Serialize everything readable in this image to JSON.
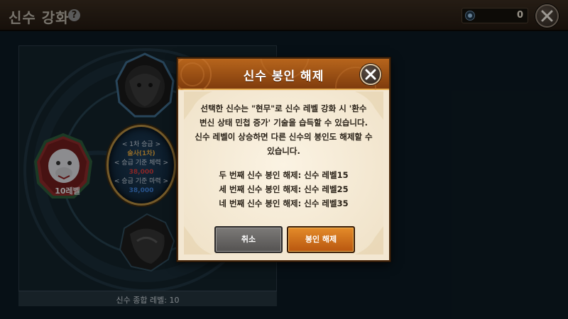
{
  "topbar": {
    "title": "신수 강화",
    "help_icon": "question-icon",
    "currency_icon": "gem-icon",
    "currency_value": "0",
    "close_icon": "close-icon"
  },
  "background": {
    "left_slot_level": "10레벨",
    "medallion": {
      "line1": "< 1차 승급 >",
      "line2": "술사(1차)",
      "line3": "< 승급 기준 체력 >",
      "line4": "38,000",
      "line5": "< 승급 기준 마력 >",
      "line6": "38,000"
    },
    "total_level_label": "신수 종합 레벨: 10"
  },
  "modal": {
    "title": "신수 봉인 해제",
    "description": [
      "선택한 신수는 \"현무\"로 신수 레벨 강화 시 '환수",
      "변신 상태 민첩 증가' 기술을 습득할 수 있습니다.",
      "신수 레벨이 상승하면 다른 신수의 봉인도 해제할 수",
      "있습니다."
    ],
    "unlocks": [
      "두 번째 신수 봉인 해제: 신수 레벨15",
      "세 번째 신수 봉인 해제: 신수 레벨25",
      "네 번째 신수 봉인 해제: 신수 레벨35"
    ],
    "cancel_label": "취소",
    "confirm_label": "봉인 해제"
  },
  "colors": {
    "header_orange": "#a4531a",
    "parchment": "#f3e7d2",
    "gold_text": "#e0a640",
    "red_stat": "#d23a3a",
    "blue_stat": "#3d7fd6"
  }
}
